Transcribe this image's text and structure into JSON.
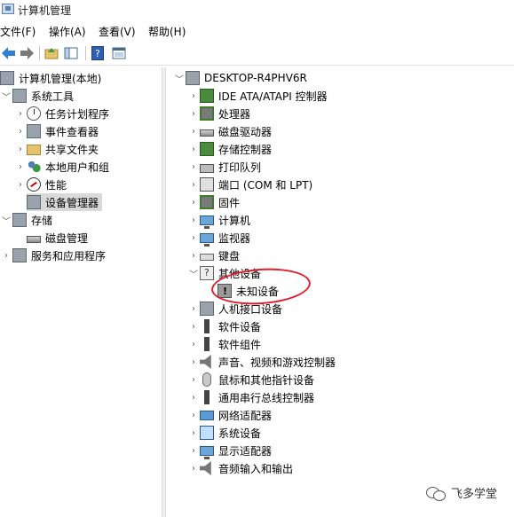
{
  "window": {
    "title": "计算机管理"
  },
  "menu": [
    "文件(F)",
    "操作(A)",
    "查看(V)",
    "帮助(H)"
  ],
  "toolbar": [
    "back-icon",
    "forward-icon",
    "up-folder-icon",
    "show-hide-tree-icon",
    "help-icon",
    "properties-icon"
  ],
  "left_tree": {
    "root": "计算机管理(本地)",
    "system_tools": "系统工具",
    "task_scheduler": "任务计划程序",
    "event_viewer": "事件查看器",
    "shared_folders": "共享文件夹",
    "local_users": "本地用户和组",
    "performance": "性能",
    "device_manager": "设备管理器",
    "storage": "存储",
    "disk_management": "磁盘管理",
    "services": "服务和应用程序"
  },
  "device_tree": {
    "root": "DESKTOP-R4PHV6R",
    "categories": [
      "IDE ATA/ATAPI 控制器",
      "处理器",
      "磁盘驱动器",
      "存储控制器",
      "打印队列",
      "端口 (COM 和 LPT)",
      "固件",
      "计算机",
      "监视器",
      "键盘",
      "其他设备",
      "人机接口设备",
      "软件设备",
      "软件组件",
      "声音、视频和游戏控制器",
      "鼠标和其他指针设备",
      "通用串行总线控制器",
      "网络适配器",
      "系统设备",
      "显示适配器",
      "音频输入和输出"
    ],
    "unknown_device": "未知设备"
  },
  "annotation_color": "#e21c2a",
  "watermark": {
    "text": "飞多学堂"
  }
}
